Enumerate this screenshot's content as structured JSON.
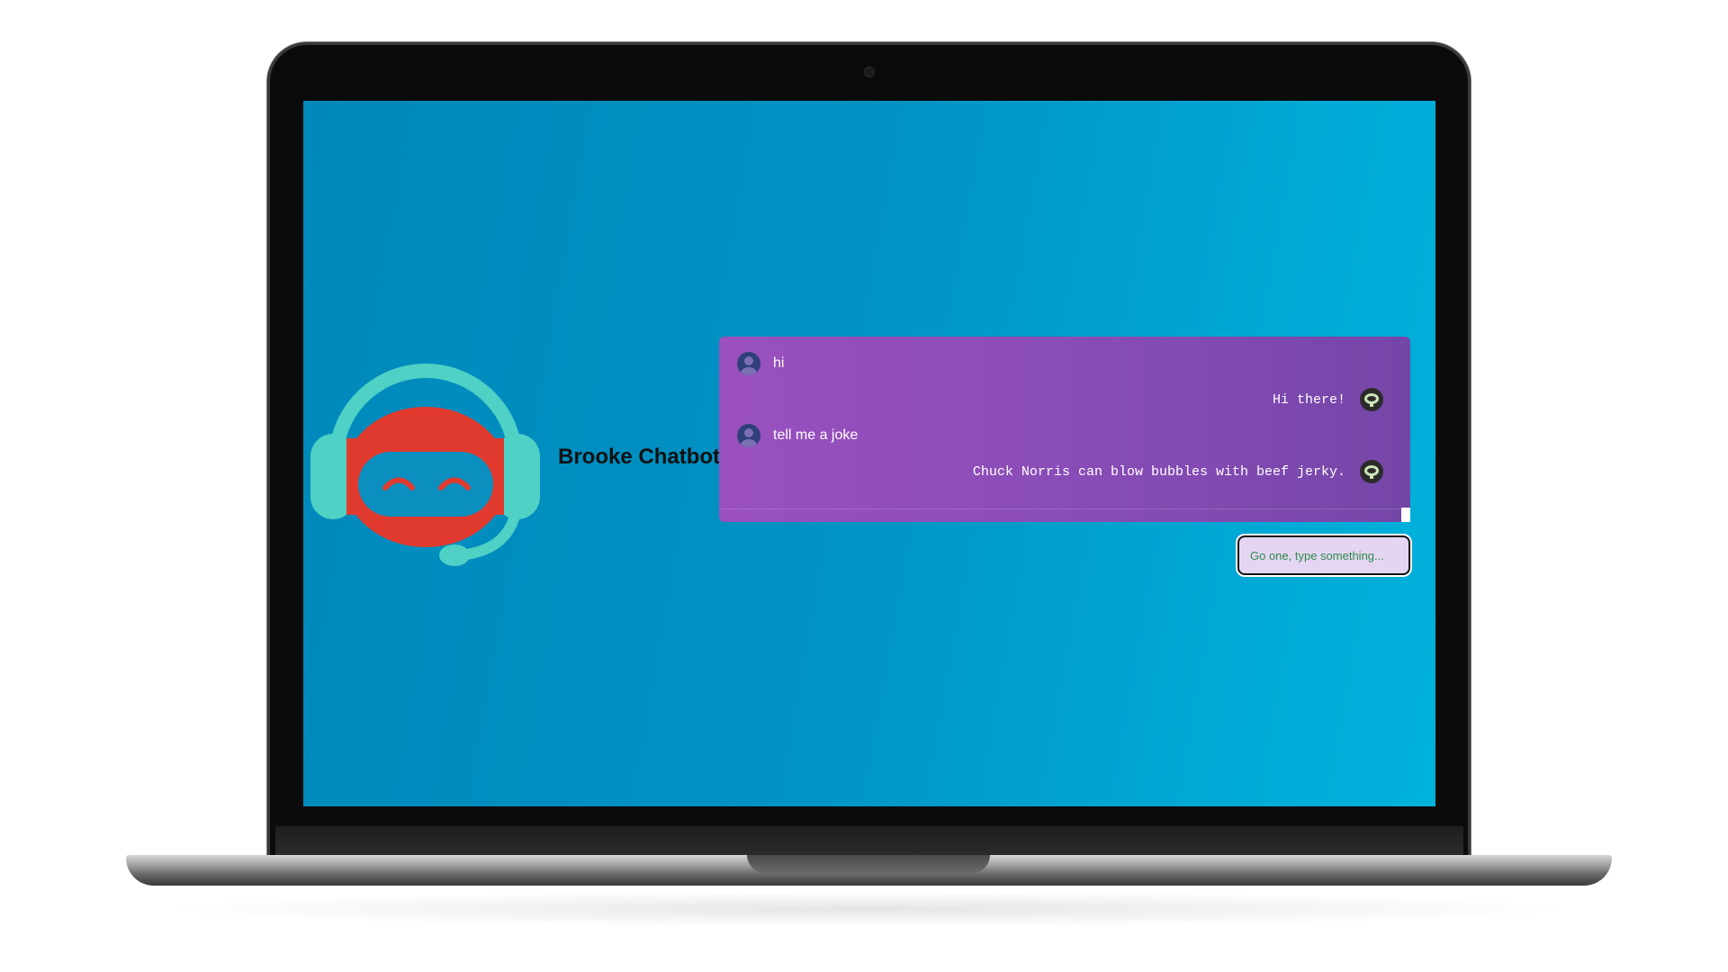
{
  "app": {
    "title": "Brooke Chatbot"
  },
  "chat": {
    "messages": [
      {
        "sender": "user",
        "text": "hi"
      },
      {
        "sender": "bot",
        "text": "Hi there!"
      },
      {
        "sender": "user",
        "text": "tell me a joke"
      },
      {
        "sender": "bot",
        "text": "Chuck Norris can blow bubbles with beef jerky."
      }
    ]
  },
  "input": {
    "placeholder": "Go one, type something..."
  },
  "colors": {
    "screen_background": "#0091c3",
    "chat_panel": "#884cb6",
    "robot_face": "#e03a2f",
    "robot_headset": "#4fd1c5",
    "input_background": "#e4d6f2"
  },
  "icons": {
    "user_avatar": "user-avatar-icon",
    "bot_avatar": "bot-avatar-icon",
    "logo": "robot-logo-icon"
  }
}
